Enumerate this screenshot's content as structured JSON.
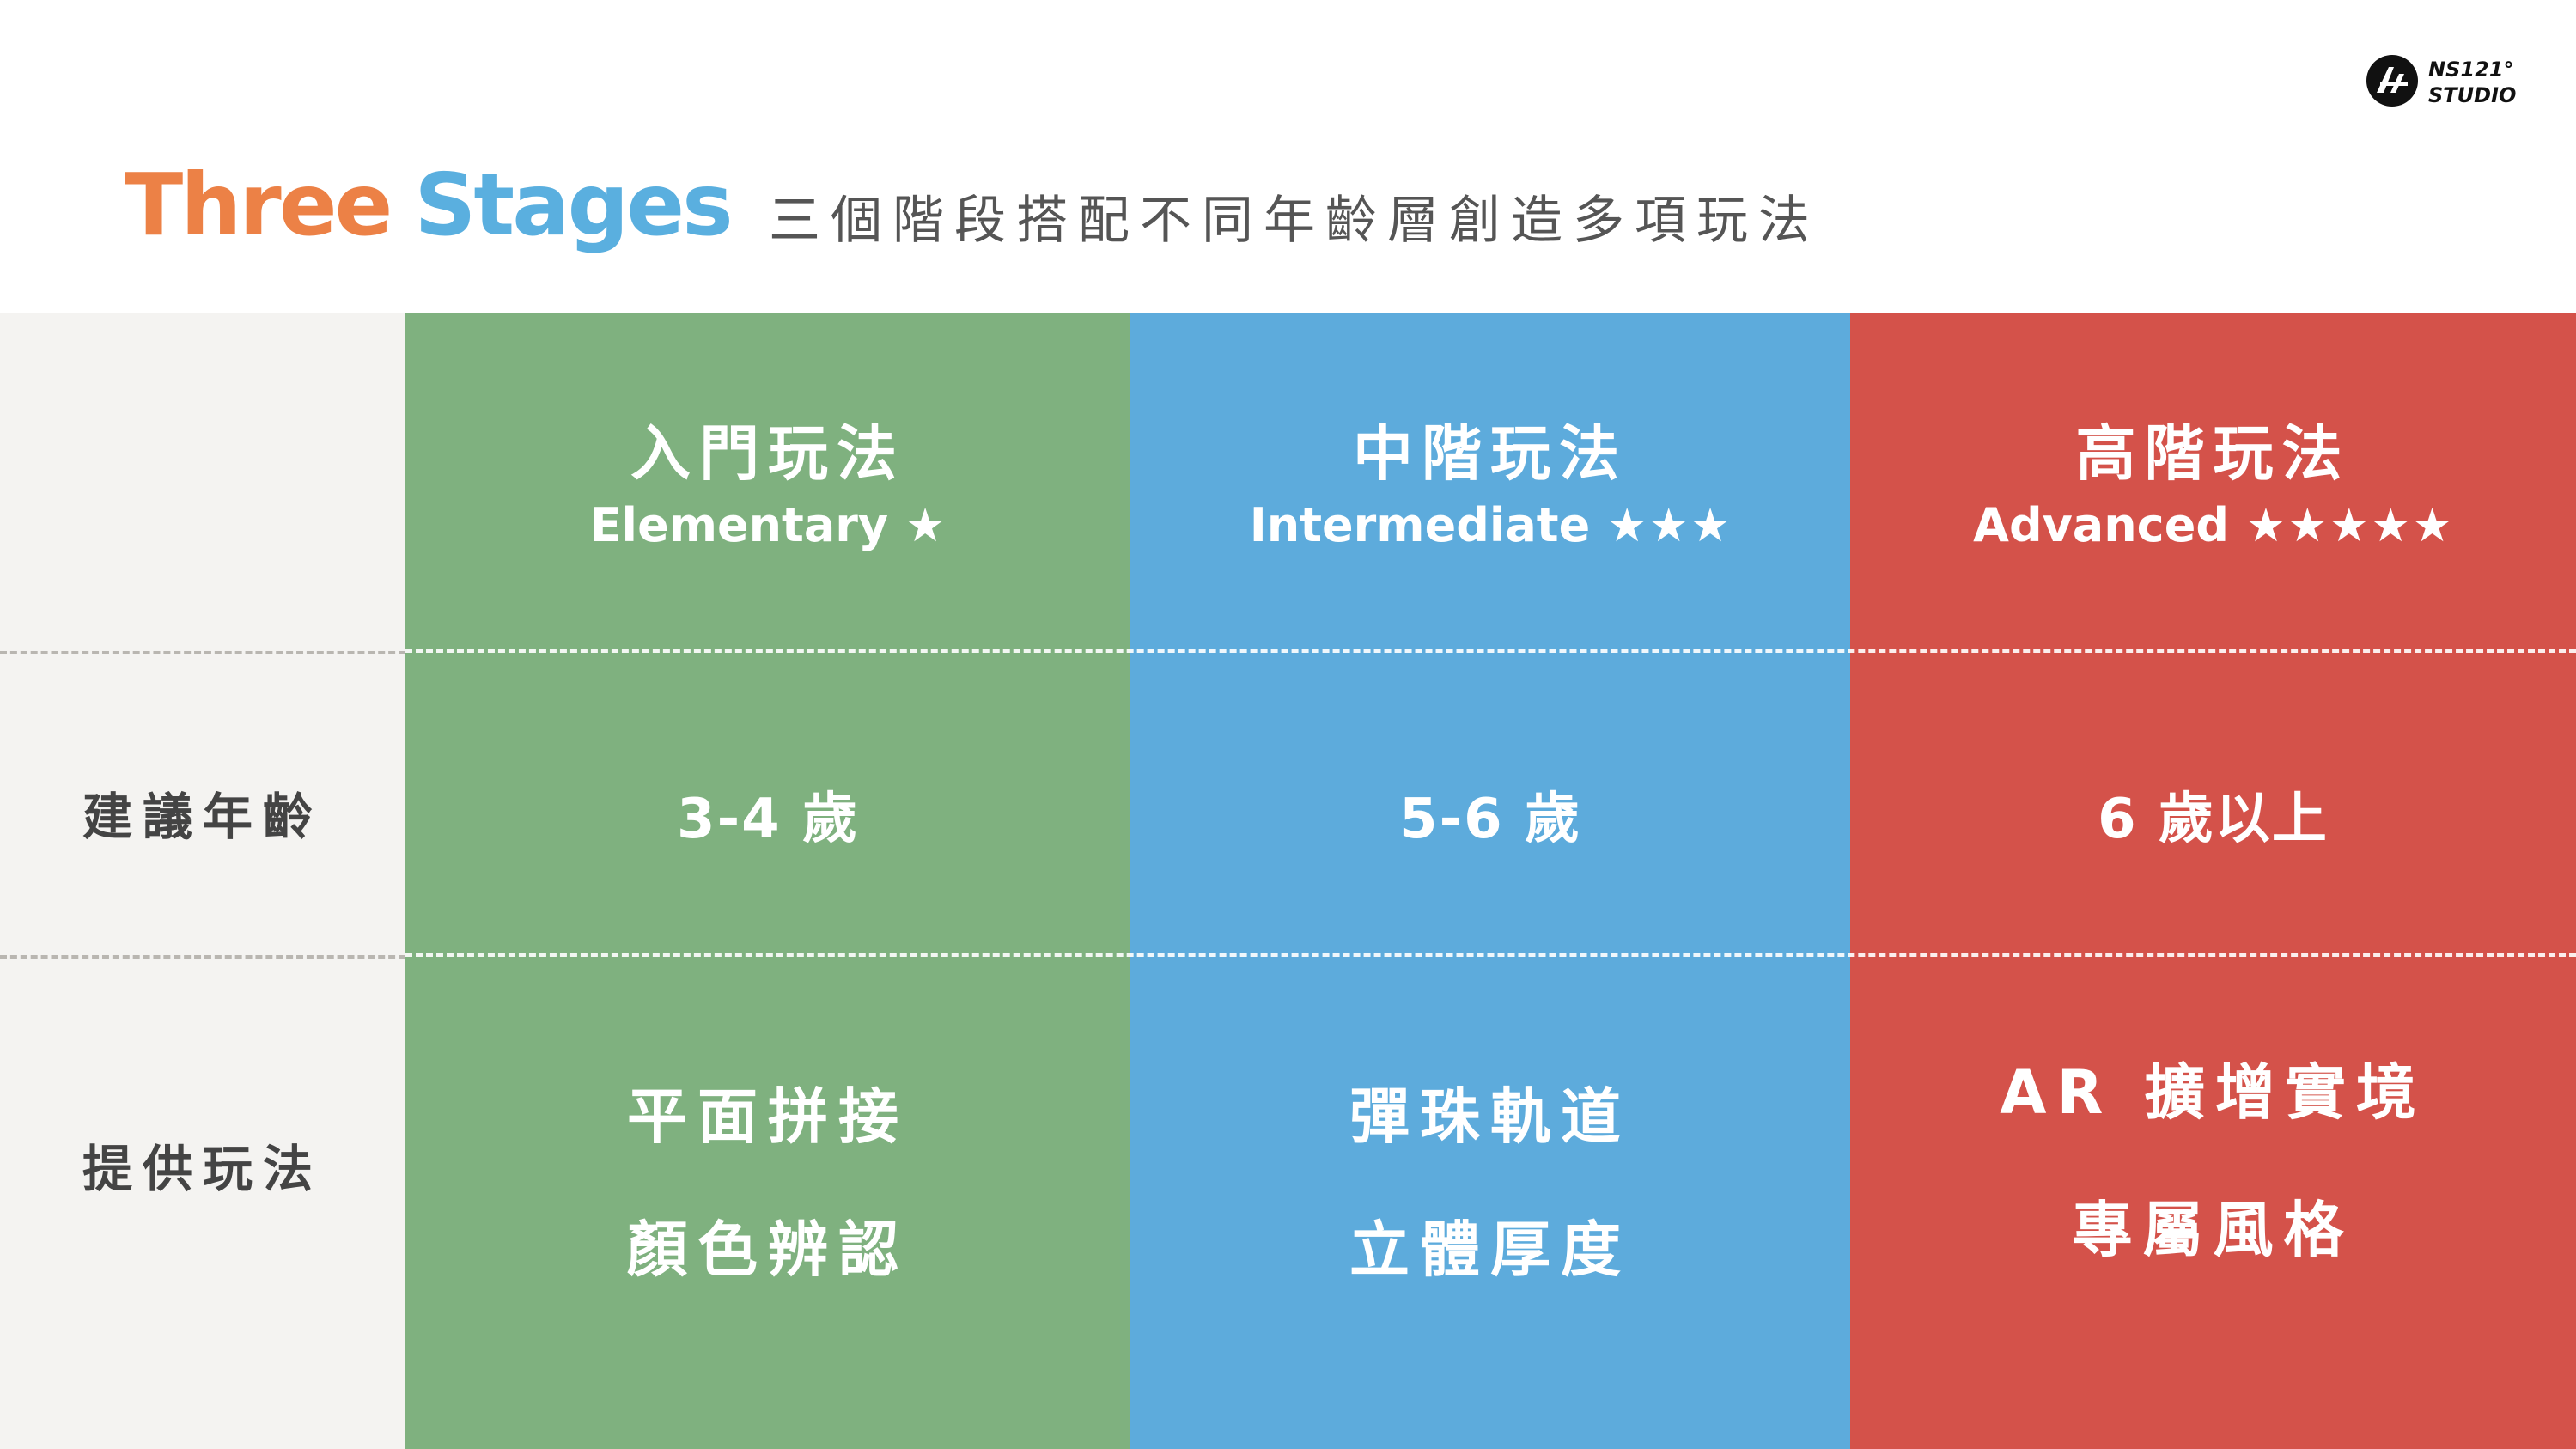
{
  "logo": {
    "line1": "NS121°",
    "line2": "STUDIO",
    "mark_text": "A"
  },
  "title": {
    "word1": "Three",
    "word2": "Stages",
    "subtitle": "三個階段搭配不同年齡層創造多項玩法"
  },
  "colors": {
    "orange": "#ec8146",
    "blue": "#5aafdf",
    "green_col": "#7fb17f",
    "blue_col": "#5dabdc",
    "red_col": "#d4524a",
    "label_col": "#f4f3f1"
  },
  "row_labels": {
    "age": "建議年齡",
    "play": "提供玩法"
  },
  "stages": [
    {
      "name": "入門玩法",
      "level": "Elementary ★",
      "age": "3-4 歲",
      "play1": "平面拼接",
      "play2": "顏色辨認"
    },
    {
      "name": "中階玩法",
      "level": "Intermediate ★★★",
      "age": "5-6 歲",
      "play1": "彈珠軌道",
      "play2": "立體厚度"
    },
    {
      "name": "高階玩法",
      "level": "Advanced ★★★★★",
      "age": "6 歲以上",
      "play1": "AR 擴增實境",
      "play2": "專屬風格"
    }
  ]
}
